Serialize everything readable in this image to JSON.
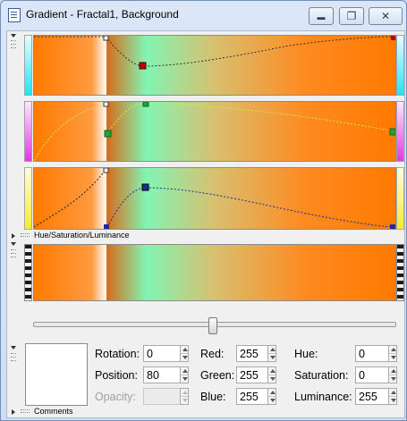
{
  "window": {
    "title": "Gradient - Fractal1, Background",
    "controls": {
      "minimize": "▬",
      "maximize": "❐",
      "close": "✕"
    }
  },
  "sections": {
    "hsl_label": "Hue/Saturation/Luminance",
    "comments_label": "Comments"
  },
  "gradient": {
    "colors": {
      "orange": "#ff7a00",
      "white": "#ffffff",
      "mint": "#82f5b4"
    },
    "red_handle_color": "#c00000",
    "green_handle_color": "#2ea02e",
    "blue_handle_color": "#1a2f9a"
  },
  "slider": {
    "value_fraction": 0.5
  },
  "properties": {
    "rotation": {
      "label": "Rotation:",
      "value": "0"
    },
    "position": {
      "label": "Position:",
      "value": "80"
    },
    "opacity": {
      "label": "Opacity:",
      "value": ""
    },
    "red": {
      "label": "Red:",
      "value": "255"
    },
    "green": {
      "label": "Green:",
      "value": "255"
    },
    "blue": {
      "label": "Blue:",
      "value": "255"
    },
    "hue": {
      "label": "Hue:",
      "value": "0"
    },
    "saturation": {
      "label": "Saturation:",
      "value": "0"
    },
    "luminance": {
      "label": "Luminance:",
      "value": "255"
    }
  }
}
